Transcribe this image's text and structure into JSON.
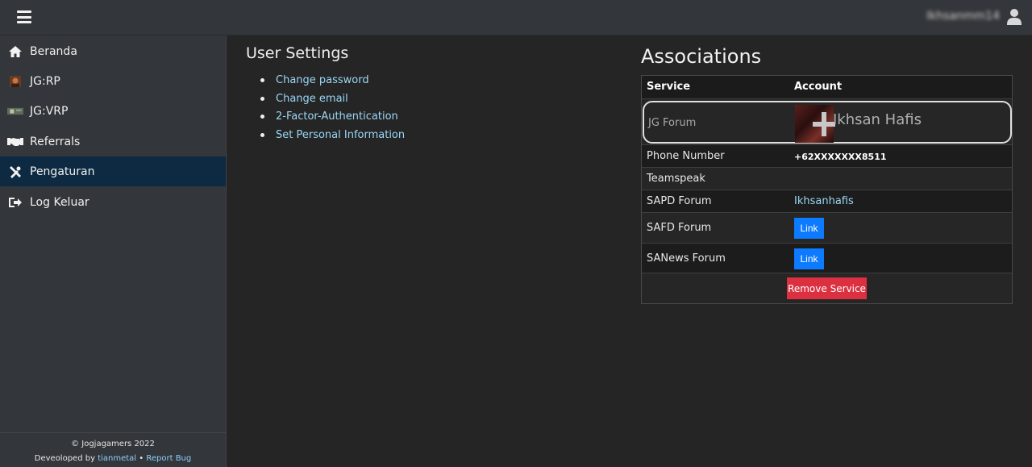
{
  "topbar": {
    "user_name": "Ikhsanmm14"
  },
  "sidebar": {
    "items": [
      {
        "label": "Beranda",
        "icon": "home-icon"
      },
      {
        "label": "JG:RP",
        "icon": "jgrp-icon"
      },
      {
        "label": "JG:VRP",
        "icon": "jgvrp-icon"
      },
      {
        "label": "Referrals",
        "icon": "handshake-icon"
      },
      {
        "label": "Pengaturan",
        "icon": "tools-icon",
        "active": true
      },
      {
        "label": "Log Keluar",
        "icon": "sign-out-icon"
      }
    ],
    "footer": {
      "copyright": "© Jogjagamers 2022",
      "developed_by": "Deveoloped by",
      "author": "tianmetal",
      "separator": "•",
      "report_bug": "Report Bug"
    }
  },
  "settings": {
    "title": "User Settings",
    "links": [
      "Change password",
      "Change email",
      "2-Factor-Authentication",
      "Set Personal Information"
    ]
  },
  "associations": {
    "title": "Associations",
    "headers": {
      "service": "Service",
      "account": "Account"
    },
    "jg_forum": {
      "service": "JG Forum",
      "account": "Ikhsan Hafis"
    },
    "phone": {
      "service": "Phone Number",
      "account": "+62XXXXXXX8511"
    },
    "teamspeak": {
      "service": "Teamspeak",
      "account": ""
    },
    "sapd": {
      "service": "SAPD Forum",
      "account": "Ikhsanhafis"
    },
    "safd": {
      "service": "SAFD Forum",
      "button": "Link"
    },
    "sanews": {
      "service": "SANews Forum",
      "button": "Link"
    },
    "remove_button": "Remove Service"
  },
  "colors": {
    "background": "#252525",
    "sidebar": "#33363a",
    "active_nav": "#0d2a42",
    "link": "#9ad7f5",
    "primary_button": "#0d7bff",
    "danger_button": "#dc3040"
  }
}
